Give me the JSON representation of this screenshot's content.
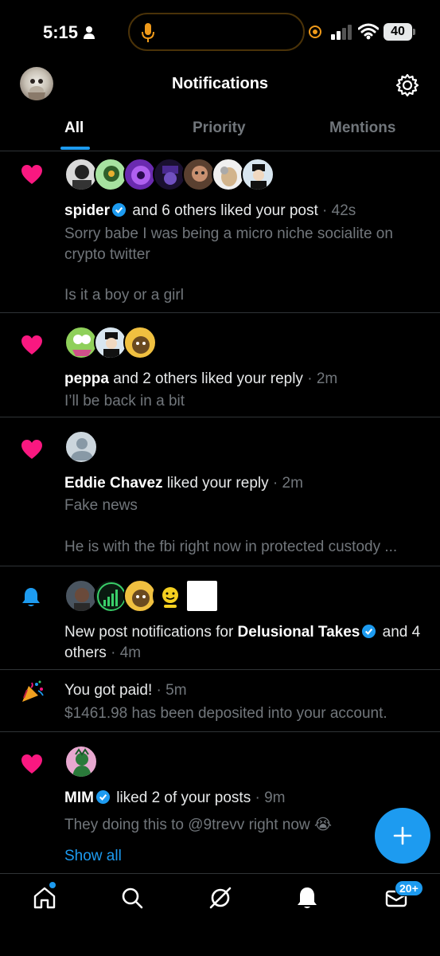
{
  "status_bar": {
    "time": "5:15",
    "battery": "40"
  },
  "header": {
    "title": "Notifications"
  },
  "tabs": [
    {
      "label": "All",
      "active": true
    },
    {
      "label": "Priority",
      "active": false
    },
    {
      "label": "Mentions",
      "active": false
    }
  ],
  "notifications": [
    {
      "type": "like",
      "icon": "heart-icon",
      "actor": "spider",
      "verified": true,
      "text": "and 6 others liked your post",
      "time": "42s",
      "body_1": "Sorry babe I was being a micro niche socialite on",
      "body_2": "crypto twitter",
      "body_3": "Is it a boy or a girl"
    },
    {
      "type": "like",
      "icon": "heart-icon",
      "actor": "peppa",
      "verified": false,
      "text": "and 2 others liked your reply",
      "time": "2m",
      "body_1": "I’ll be back in a bit"
    },
    {
      "type": "like",
      "icon": "heart-icon",
      "actor": "Eddie Chavez",
      "verified": false,
      "text": "liked your reply",
      "time": "2m",
      "body_1": "Fake news",
      "body_2": "He is with the fbi right now in protected custody ..."
    },
    {
      "type": "new_post",
      "icon": "bell-icon",
      "prefix": "New post notifications for",
      "actor": "Delusional Takes",
      "verified": true,
      "suffix": "and",
      "suffix_2": "4 others",
      "time": "4m"
    },
    {
      "type": "payment",
      "icon": "party-popper-icon",
      "text": "You got paid!",
      "time": "5m",
      "body_1": "$1461.98 has been deposited into your account."
    },
    {
      "type": "like",
      "icon": "heart-icon",
      "actor": "MIM",
      "verified": true,
      "text": "liked 2 of your posts",
      "time": "9m",
      "body_1": "They doing this to @9trevv right now 😭",
      "link": "Show all"
    }
  ],
  "bottom_nav": {
    "items": [
      "home-icon",
      "search-icon",
      "grok-icon",
      "bell-icon",
      "mail-icon"
    ],
    "badge": "20+"
  },
  "colors": {
    "accent": "#1d9bf0",
    "heart": "#f91880",
    "background": "#000000",
    "muted": "#71767b"
  }
}
